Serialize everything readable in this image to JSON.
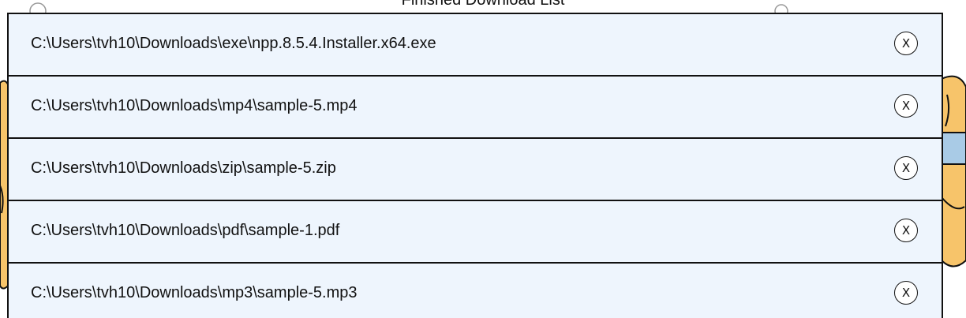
{
  "title": "Finished Download List",
  "items": [
    {
      "path": "C:\\Users\\tvh10\\Downloads\\exe\\npp.8.5.4.Installer.x64.exe",
      "remove_label": "X"
    },
    {
      "path": "C:\\Users\\tvh10\\Downloads\\mp4\\sample-5.mp4",
      "remove_label": "X"
    },
    {
      "path": "C:\\Users\\tvh10\\Downloads\\zip\\sample-5.zip",
      "remove_label": "X"
    },
    {
      "path": "C:\\Users\\tvh10\\Downloads\\pdf\\sample-1.pdf",
      "remove_label": "X"
    },
    {
      "path": "C:\\Users\\tvh10\\Downloads\\mp3\\sample-5.mp3",
      "remove_label": "X"
    }
  ],
  "colors": {
    "row_background": "#eef5fd",
    "border": "#111111",
    "art_fill": "#f7c46a",
    "art_accent": "#a9cbe6"
  }
}
